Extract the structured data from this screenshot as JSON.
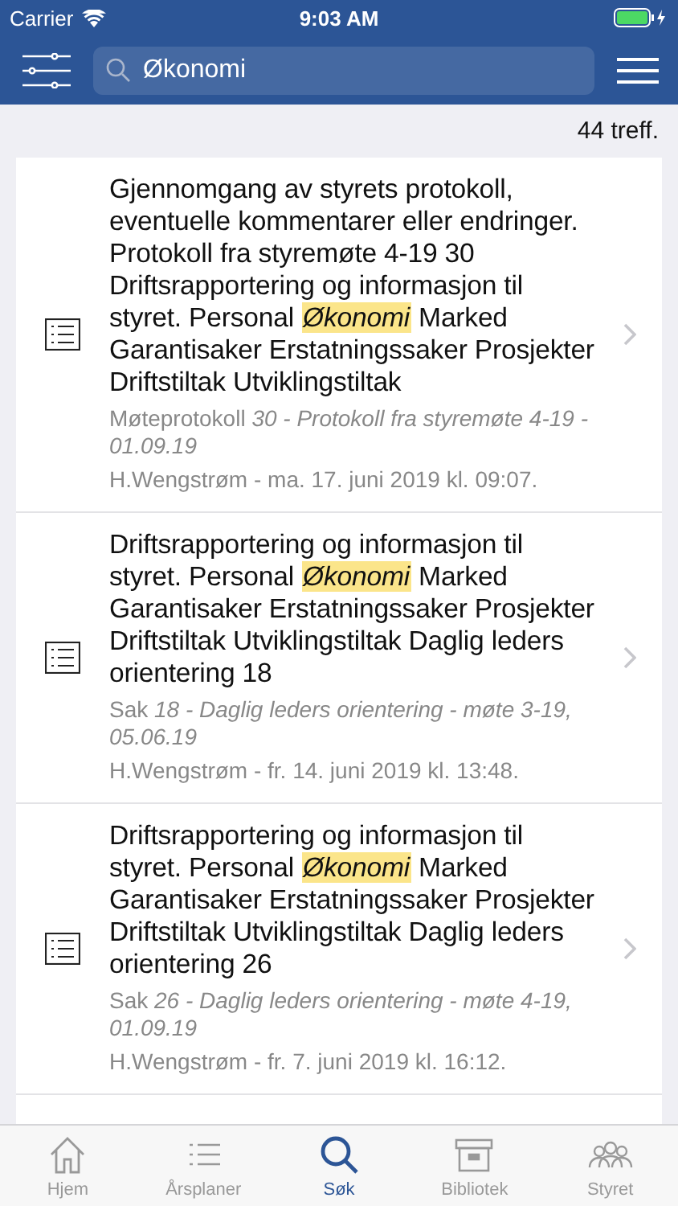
{
  "status_bar": {
    "carrier": "Carrier",
    "time": "9:03 AM"
  },
  "search": {
    "value": "Økonomi"
  },
  "result_count": "44 treff.",
  "results": [
    {
      "text": "Gjennomgang av styrets protokoll, eventuelle kommentarer eller endringer. Protokoll fra styremøte 4-19 30 Driftsrapportering og informasjon til styret. Personal *Økonomi* Marked Garantisaker Erstatningssaker Prosjekter Driftstiltak Utviklingstiltak",
      "source": "Møteprotokoll *30 - Protokoll fra styremøte 4-19 - 01.09.19*",
      "author": "H.Wengstrøm - ma. 17. juni 2019 kl. 09:07."
    },
    {
      "text": "Driftsrapportering og informasjon til styret. Personal *Økonomi* Marked Garantisaker Erstatningssaker Prosjekter Driftstiltak Utviklingstiltak Daglig leders orientering 18",
      "source": "Sak *18 - Daglig leders orientering - møte 3-19, 05.06.19*",
      "author": "H.Wengstrøm - fr. 14. juni 2019 kl. 13:48."
    },
    {
      "text": "Driftsrapportering og informasjon til styret. Personal *Økonomi* Marked Garantisaker Erstatningssaker Prosjekter Driftstiltak Utviklingstiltak Daglig leders orientering 26",
      "source": "Sak *26 - Daglig leders orientering - møte 4-19, 01.09.19*",
      "author": "H.Wengstrøm - fr. 7. juni 2019 kl. 16:12."
    }
  ],
  "tabs": [
    {
      "kind": "home",
      "label": "Hjem",
      "selected": false
    },
    {
      "kind": "list",
      "label": "Årsplaner",
      "selected": false
    },
    {
      "kind": "search",
      "label": "Søk",
      "selected": true
    },
    {
      "kind": "archive",
      "label": "Bibliotek",
      "selected": false
    },
    {
      "kind": "people",
      "label": "Styret",
      "selected": false
    }
  ]
}
